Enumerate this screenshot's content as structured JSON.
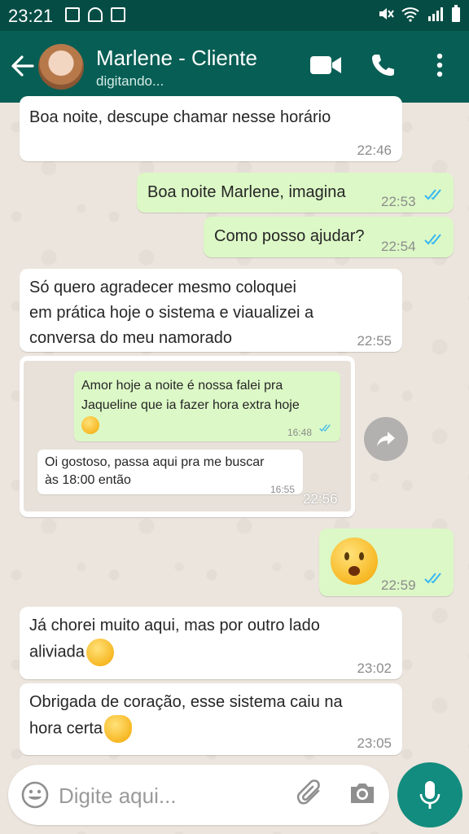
{
  "status_bar": {
    "time": "23:21"
  },
  "header": {
    "contact_name": "Marlene - Cliente",
    "status": "digitando..."
  },
  "messages": [
    {
      "direction": "in",
      "text": "Boa noite, descupe chamar nesse horário",
      "time": "22:46"
    },
    {
      "direction": "out",
      "text": "Boa noite Marlene, imagina",
      "time": "22:53",
      "read": true
    },
    {
      "direction": "out",
      "text": "Como posso ajudar?",
      "time": "22:54",
      "read": true
    },
    {
      "direction": "in",
      "lines": [
        "Só quero agradecer mesmo coloquei",
        "em prática hoje o sistema e viaualizei a",
        "conversa do meu namorado"
      ],
      "time": "22:55"
    },
    {
      "direction": "in",
      "type": "image",
      "time": "22:56",
      "screenshot": {
        "outgoing": {
          "lines": [
            "Amor hoje a noite é nossa falei pra",
            "Jaqueline que ia fazer hora extra hoje"
          ],
          "emoji": "smirk-emoji",
          "time": "16:48"
        },
        "incoming": {
          "lines": [
            "Oi gostoso, passa aqui pra me buscar",
            "às  18:00 então"
          ],
          "time": "16:55"
        }
      }
    },
    {
      "direction": "out",
      "type": "emoji",
      "emoji": "worried-face-emoji",
      "time": "22:59",
      "read": true
    },
    {
      "direction": "in",
      "lines": [
        "Já chorei muito aqui, mas por outro lado",
        "aliviada"
      ],
      "emoji": "unamused-face-emoji",
      "time": "23:02"
    },
    {
      "direction": "in",
      "lines": [
        "Obrigada de coração, esse sistema caiu na",
        "hora certa"
      ],
      "emoji": "clapping-hands-emoji",
      "time": "23:05"
    }
  ],
  "composer": {
    "placeholder": "Digite aqui..."
  },
  "colors": {
    "header": "#075e54",
    "status_bar": "#054d44",
    "outgoing_bubble": "#dcf8c6",
    "incoming_bubble": "#ffffff",
    "read_ticks": "#34b7f1",
    "mic_button": "#128c7e"
  }
}
